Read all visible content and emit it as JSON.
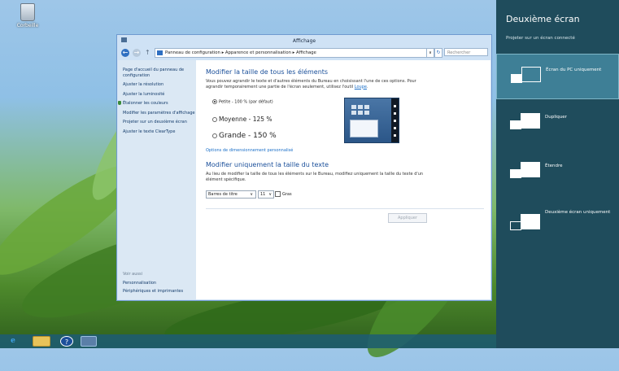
{
  "desktop": {
    "recycle_label": "Corbeille"
  },
  "window": {
    "title": "Affichage",
    "address": "Panneau de configuration  ▸  Apparence et personnalisation  ▸  Affichage",
    "search_placeholder": "Rechercher"
  },
  "sidebar": {
    "items": [
      "Page d'accueil du panneau de configuration",
      "Ajuster la résolution",
      "Ajuster la luminosité",
      "Étalonner les couleurs",
      "Modifier les paramètres d'affichage",
      "Projeter sur un deuxième écran",
      "Ajuster le texte ClearType"
    ],
    "see_also": "Voir aussi",
    "bottom_links": [
      "Personnalisation",
      "Périphériques et imprimantes"
    ]
  },
  "main": {
    "heading": "Modifier la taille de tous les éléments",
    "description": "Vous pouvez agrandir le texte et d'autres éléments du Bureau en choisissant l'une de ces options. Pour agrandir temporairement une partie de l'écran seulement, utilisez l'outil",
    "loupe_link": "Loupe",
    "options": [
      {
        "label": "Petite - 100 % (par défaut)",
        "selected": true
      },
      {
        "label": "Moyenne - 125 %",
        "selected": false
      },
      {
        "label": "Grande - 150 %",
        "selected": false
      }
    ],
    "custom_link": "Options de dimensionnement personnalisé",
    "heading2": "Modifier uniquement la taille du texte",
    "description2": "Au lieu de modifier la taille de tous les éléments sur le Bureau, modifiez uniquement la taille du texte d'un élément spécifique.",
    "element_select": "Barres de titre",
    "size_select": "11",
    "bold_label": "Gras",
    "apply_button": "Appliquer"
  },
  "charm": {
    "title": "Deuxième écran",
    "subtitle": "Projeter sur un écran connecté",
    "options": [
      {
        "label": "Écran du PC uniquement",
        "selected": true
      },
      {
        "label": "Dupliquer",
        "selected": false
      },
      {
        "label": "Étendre",
        "selected": false
      },
      {
        "label": "Deuxième écran uniquement",
        "selected": false
      }
    ]
  },
  "taskbar": {
    "help_label": "?"
  },
  "colors": {
    "charm_bg": "#1f4c5c",
    "selected_bg": "#3e7f96",
    "link": "#1a6fc8",
    "heading": "#1a4f9a"
  }
}
